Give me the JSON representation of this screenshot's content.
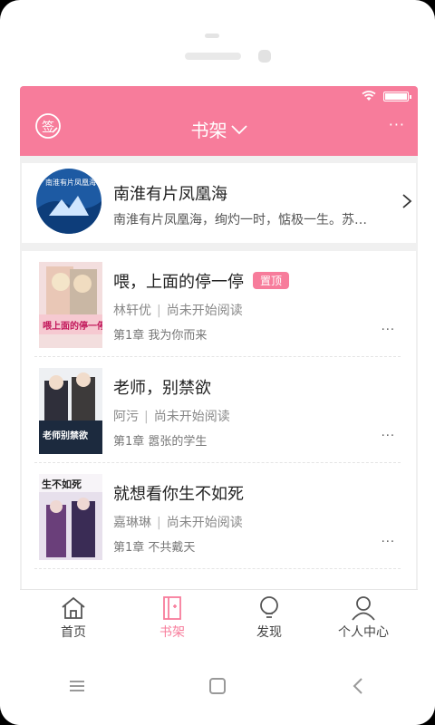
{
  "header": {
    "title": "书架",
    "sign_icon_text": "签",
    "more_label": "···"
  },
  "recommend": {
    "title": "南淮有片凤凰海",
    "description": "南淮有片凤凰海，绚灼一时，惦极一生。苏…",
    "cover_text": "南淮有片凤凰海"
  },
  "books": [
    {
      "title": "喂，上面的停一停",
      "pinned_label": "置顶",
      "author": "林轩优",
      "status": "尚未开始阅读",
      "chapter": "第1章 我为你而来",
      "cover_text": "喂上面的停一停",
      "more": "···"
    },
    {
      "title": "老师，别禁欲",
      "author": "阿污",
      "status": "尚未开始阅读",
      "chapter": "第1章 嚣张的学生",
      "cover_text": "老师别禁欲",
      "more": "···"
    },
    {
      "title": "就想看你生不如死",
      "author": "嘉琳琳",
      "status": "尚未开始阅读",
      "chapter": "第1章 不共戴天",
      "cover_text": "生不如死",
      "more": "···"
    }
  ],
  "tabs": [
    {
      "label": "首页",
      "icon": "home-icon"
    },
    {
      "label": "书架",
      "icon": "bookshelf-icon",
      "active": true
    },
    {
      "label": "发现",
      "icon": "bulb-icon"
    },
    {
      "label": "个人中心",
      "icon": "user-icon"
    }
  ],
  "colors": {
    "accent": "#f77c9b",
    "background": "#f0f0f0"
  }
}
